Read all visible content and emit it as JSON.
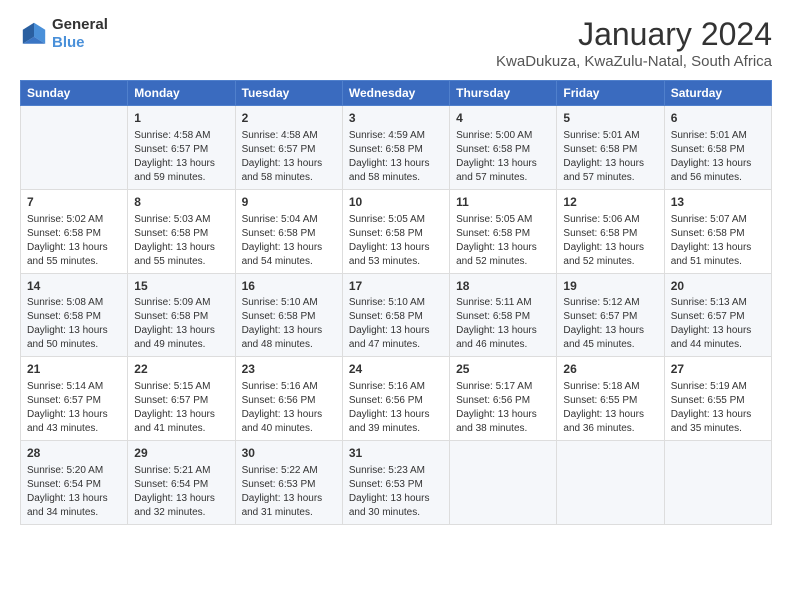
{
  "logo": {
    "text_general": "General",
    "text_blue": "Blue"
  },
  "title": "January 2024",
  "subtitle": "KwaDukuza, KwaZulu-Natal, South Africa",
  "headers": [
    "Sunday",
    "Monday",
    "Tuesday",
    "Wednesday",
    "Thursday",
    "Friday",
    "Saturday"
  ],
  "weeks": [
    [
      {
        "day": "",
        "info": ""
      },
      {
        "day": "1",
        "info": "Sunrise: 4:58 AM\nSunset: 6:57 PM\nDaylight: 13 hours\nand 59 minutes."
      },
      {
        "day": "2",
        "info": "Sunrise: 4:58 AM\nSunset: 6:57 PM\nDaylight: 13 hours\nand 58 minutes."
      },
      {
        "day": "3",
        "info": "Sunrise: 4:59 AM\nSunset: 6:58 PM\nDaylight: 13 hours\nand 58 minutes."
      },
      {
        "day": "4",
        "info": "Sunrise: 5:00 AM\nSunset: 6:58 PM\nDaylight: 13 hours\nand 57 minutes."
      },
      {
        "day": "5",
        "info": "Sunrise: 5:01 AM\nSunset: 6:58 PM\nDaylight: 13 hours\nand 57 minutes."
      },
      {
        "day": "6",
        "info": "Sunrise: 5:01 AM\nSunset: 6:58 PM\nDaylight: 13 hours\nand 56 minutes."
      }
    ],
    [
      {
        "day": "7",
        "info": "Sunrise: 5:02 AM\nSunset: 6:58 PM\nDaylight: 13 hours\nand 55 minutes."
      },
      {
        "day": "8",
        "info": "Sunrise: 5:03 AM\nSunset: 6:58 PM\nDaylight: 13 hours\nand 55 minutes."
      },
      {
        "day": "9",
        "info": "Sunrise: 5:04 AM\nSunset: 6:58 PM\nDaylight: 13 hours\nand 54 minutes."
      },
      {
        "day": "10",
        "info": "Sunrise: 5:05 AM\nSunset: 6:58 PM\nDaylight: 13 hours\nand 53 minutes."
      },
      {
        "day": "11",
        "info": "Sunrise: 5:05 AM\nSunset: 6:58 PM\nDaylight: 13 hours\nand 52 minutes."
      },
      {
        "day": "12",
        "info": "Sunrise: 5:06 AM\nSunset: 6:58 PM\nDaylight: 13 hours\nand 52 minutes."
      },
      {
        "day": "13",
        "info": "Sunrise: 5:07 AM\nSunset: 6:58 PM\nDaylight: 13 hours\nand 51 minutes."
      }
    ],
    [
      {
        "day": "14",
        "info": "Sunrise: 5:08 AM\nSunset: 6:58 PM\nDaylight: 13 hours\nand 50 minutes."
      },
      {
        "day": "15",
        "info": "Sunrise: 5:09 AM\nSunset: 6:58 PM\nDaylight: 13 hours\nand 49 minutes."
      },
      {
        "day": "16",
        "info": "Sunrise: 5:10 AM\nSunset: 6:58 PM\nDaylight: 13 hours\nand 48 minutes."
      },
      {
        "day": "17",
        "info": "Sunrise: 5:10 AM\nSunset: 6:58 PM\nDaylight: 13 hours\nand 47 minutes."
      },
      {
        "day": "18",
        "info": "Sunrise: 5:11 AM\nSunset: 6:58 PM\nDaylight: 13 hours\nand 46 minutes."
      },
      {
        "day": "19",
        "info": "Sunrise: 5:12 AM\nSunset: 6:57 PM\nDaylight: 13 hours\nand 45 minutes."
      },
      {
        "day": "20",
        "info": "Sunrise: 5:13 AM\nSunset: 6:57 PM\nDaylight: 13 hours\nand 44 minutes."
      }
    ],
    [
      {
        "day": "21",
        "info": "Sunrise: 5:14 AM\nSunset: 6:57 PM\nDaylight: 13 hours\nand 43 minutes."
      },
      {
        "day": "22",
        "info": "Sunrise: 5:15 AM\nSunset: 6:57 PM\nDaylight: 13 hours\nand 41 minutes."
      },
      {
        "day": "23",
        "info": "Sunrise: 5:16 AM\nSunset: 6:56 PM\nDaylight: 13 hours\nand 40 minutes."
      },
      {
        "day": "24",
        "info": "Sunrise: 5:16 AM\nSunset: 6:56 PM\nDaylight: 13 hours\nand 39 minutes."
      },
      {
        "day": "25",
        "info": "Sunrise: 5:17 AM\nSunset: 6:56 PM\nDaylight: 13 hours\nand 38 minutes."
      },
      {
        "day": "26",
        "info": "Sunrise: 5:18 AM\nSunset: 6:55 PM\nDaylight: 13 hours\nand 36 minutes."
      },
      {
        "day": "27",
        "info": "Sunrise: 5:19 AM\nSunset: 6:55 PM\nDaylight: 13 hours\nand 35 minutes."
      }
    ],
    [
      {
        "day": "28",
        "info": "Sunrise: 5:20 AM\nSunset: 6:54 PM\nDaylight: 13 hours\nand 34 minutes."
      },
      {
        "day": "29",
        "info": "Sunrise: 5:21 AM\nSunset: 6:54 PM\nDaylight: 13 hours\nand 32 minutes."
      },
      {
        "day": "30",
        "info": "Sunrise: 5:22 AM\nSunset: 6:53 PM\nDaylight: 13 hours\nand 31 minutes."
      },
      {
        "day": "31",
        "info": "Sunrise: 5:23 AM\nSunset: 6:53 PM\nDaylight: 13 hours\nand 30 minutes."
      },
      {
        "day": "",
        "info": ""
      },
      {
        "day": "",
        "info": ""
      },
      {
        "day": "",
        "info": ""
      }
    ]
  ]
}
